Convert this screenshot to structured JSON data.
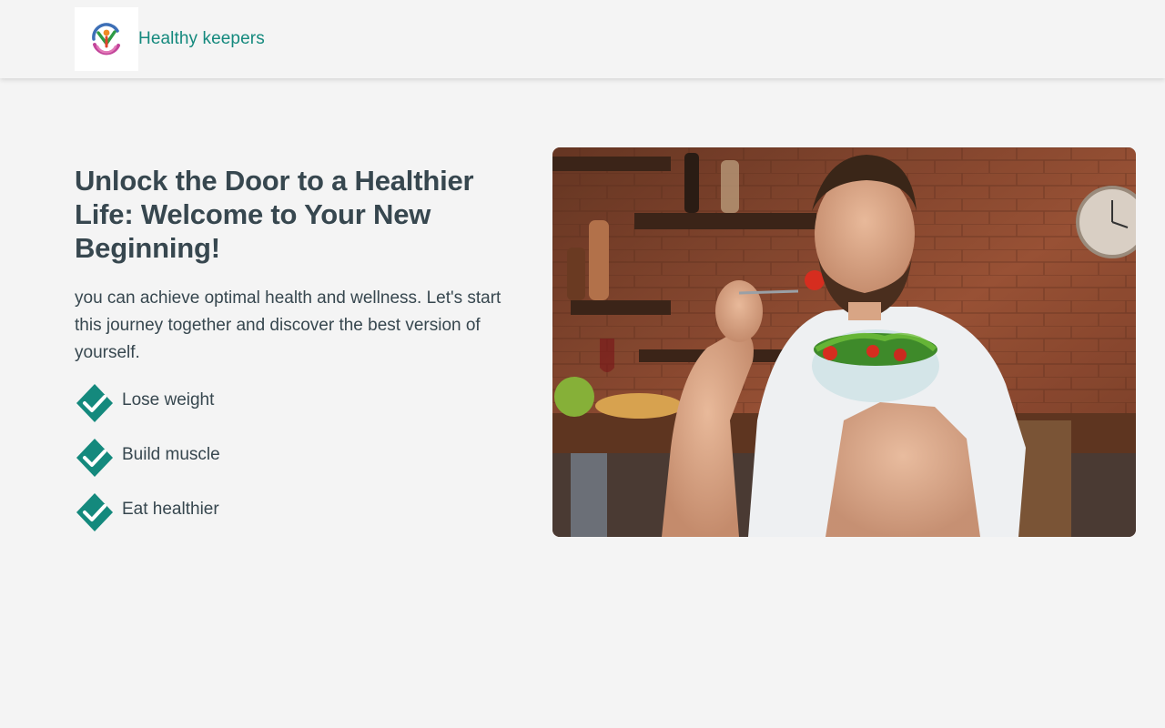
{
  "header": {
    "brand_name": "Healthy keepers",
    "logo_icon": "wellness-person-logo"
  },
  "hero": {
    "title": "Unlock the Door to a Healthier Life: Welcome to Your New Beginning!",
    "description": "you can achieve optimal health and wellness. Let's start this journey together and discover the best version of yourself.",
    "benefits": [
      {
        "label": "Lose weight",
        "icon": "check-diamond-icon"
      },
      {
        "label": "Build muscle",
        "icon": "check-diamond-icon"
      },
      {
        "label": "Eat healthier",
        "icon": "check-diamond-icon"
      }
    ],
    "image_subject": "man-eating-salad-photo"
  },
  "colors": {
    "accent": "#14897d",
    "text": "#37474f",
    "background": "#f4f4f4"
  }
}
